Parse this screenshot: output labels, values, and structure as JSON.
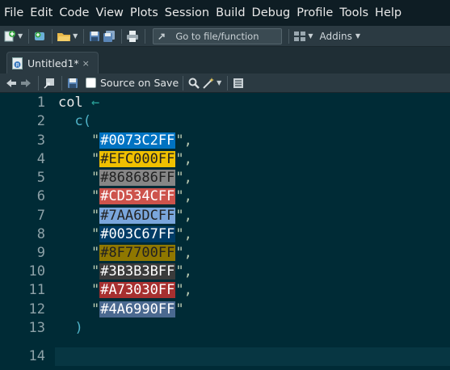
{
  "menubar": {
    "items": [
      "File",
      "Edit",
      "Code",
      "View",
      "Plots",
      "Session",
      "Build",
      "Debug",
      "Profile",
      "Tools",
      "Help"
    ]
  },
  "toolbar": {
    "goto_placeholder": "Go to file/function",
    "addins_label": "Addins"
  },
  "tab": {
    "label": "Untitled1*",
    "close": "×"
  },
  "editor_toolbar": {
    "source_on_save_label": "Source on Save"
  },
  "editor": {
    "line_numbers": [
      "1",
      "2",
      "3",
      "4",
      "5",
      "6",
      "7",
      "8",
      "9",
      "10",
      "11",
      "12",
      "13",
      "14"
    ],
    "line1_ident": "col",
    "line1_op": "←",
    "line2_fn": "c(",
    "colors": [
      {
        "hex": "#0073C2FF",
        "bg": "#0073C2",
        "sep": ","
      },
      {
        "hex": "#EFC000FF",
        "bg": "#EFC000",
        "sep": ","
      },
      {
        "hex": "#868686FF",
        "bg": "#868686",
        "sep": ","
      },
      {
        "hex": "#CD534CFF",
        "bg": "#CD534C",
        "sep": ","
      },
      {
        "hex": "#7AA6DCFF",
        "bg": "#7AA6DC",
        "sep": ","
      },
      {
        "hex": "#003C67FF",
        "bg": "#003C67",
        "sep": ","
      },
      {
        "hex": "#8F7700FF",
        "bg": "#8F7700",
        "sep": ","
      },
      {
        "hex": "#3B3B3BFF",
        "bg": "#3B3B3B",
        "sep": ","
      },
      {
        "hex": "#A73030FF",
        "bg": "#A73030",
        "sep": ","
      },
      {
        "hex": "#4A6990FF",
        "bg": "#4A6990",
        "sep": ""
      }
    ],
    "line13_close": ")"
  },
  "icons": [
    "new-file-icon",
    "new-project-icon",
    "open-folder-icon",
    "save-icon",
    "save-all-icon",
    "print-icon",
    "go-to-arrow-icon",
    "grid-panes-icon",
    "back-arrow-icon",
    "forward-arrow-icon",
    "show-in-window-icon",
    "search-icon",
    "magic-wand-icon",
    "outline-icon"
  ]
}
